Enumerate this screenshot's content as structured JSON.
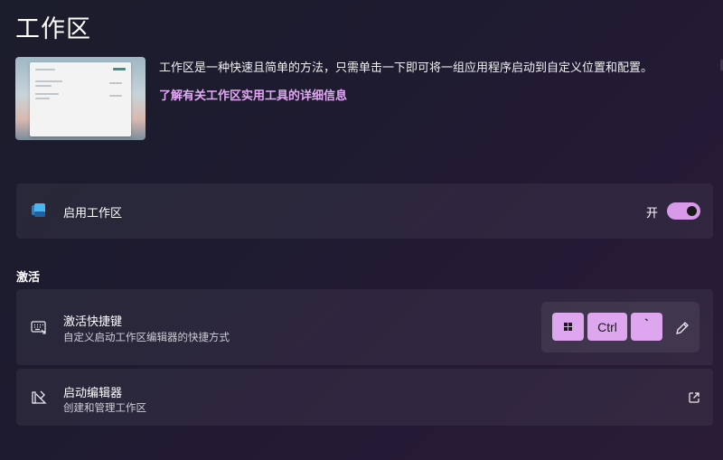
{
  "header": {
    "title": "工作区"
  },
  "hero": {
    "description": "工作区是一种快速且简单的方法，只需单击一下即可将一组应用程序启动到自定义位置和配置。",
    "learn_more_link": "了解有关工作区实用工具的详细信息"
  },
  "enable_card": {
    "icon": "workspaces-icon",
    "title": "启用工作区",
    "toggle_state": "开",
    "toggle_on": true,
    "toggle_color": "#d89ae8"
  },
  "activation": {
    "section_label": "激活",
    "shortcut": {
      "icon": "keyboard-icon",
      "title": "激活快捷键",
      "subtitle": "自定义启动工作区编辑器的快捷方式",
      "keys": [
        "windows-key-icon",
        "Ctrl",
        "`"
      ],
      "key_color": "#dda6ee",
      "edit_icon": "pencil-icon"
    }
  },
  "editor_card": {
    "icon": "editor-icon",
    "title": "启动编辑器",
    "subtitle": "创建和管理工作区",
    "open_icon": "external-link-icon"
  }
}
